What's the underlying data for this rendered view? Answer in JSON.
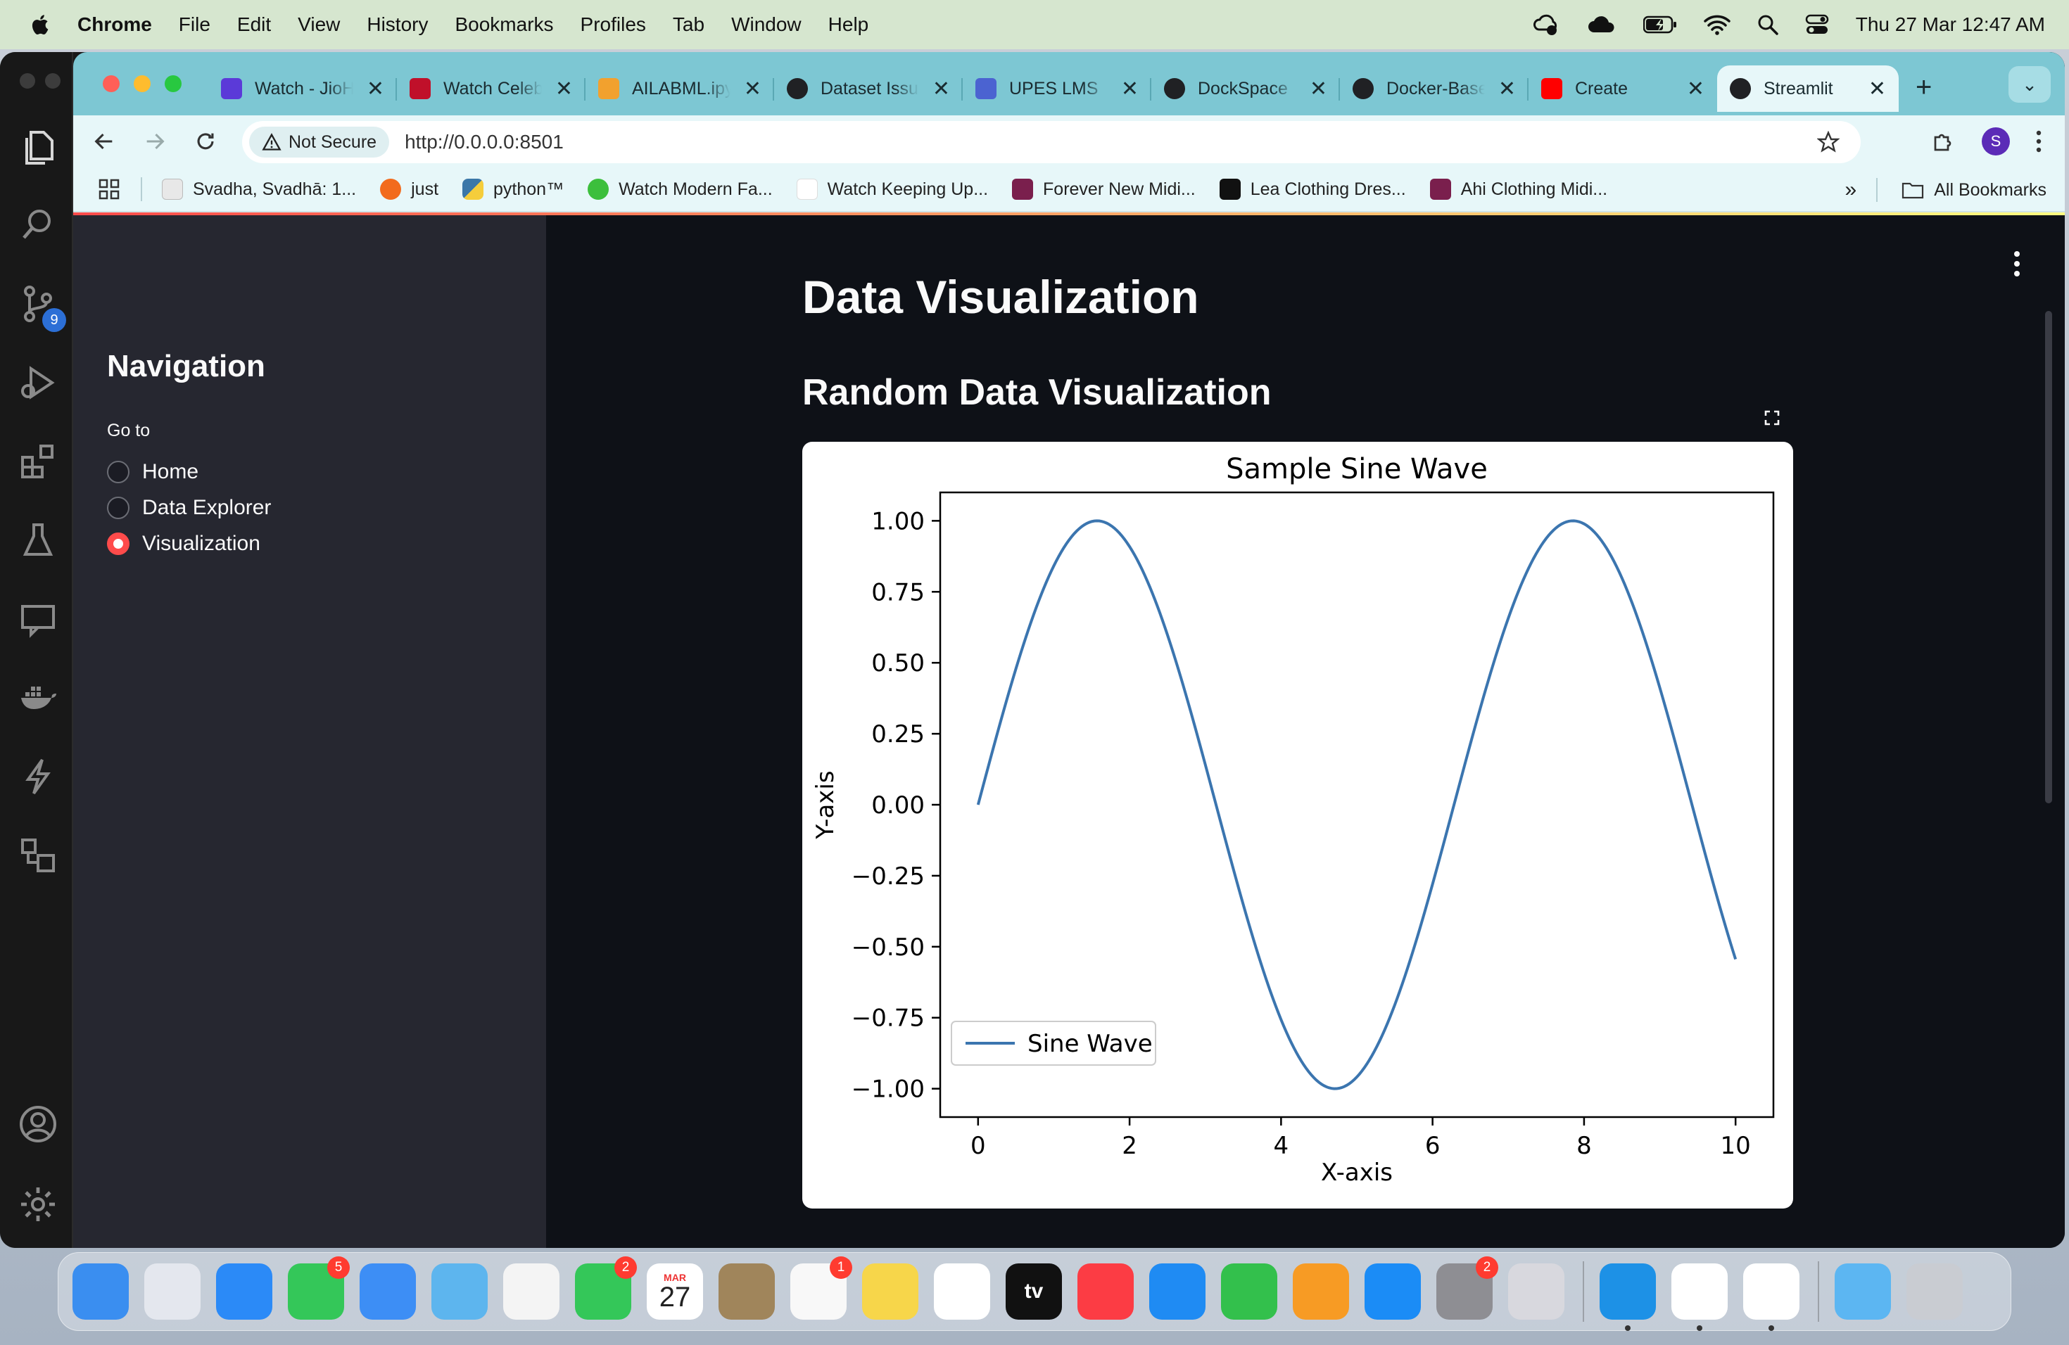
{
  "menubar": {
    "app_name": "Chrome",
    "items": [
      "File",
      "Edit",
      "View",
      "History",
      "Bookmarks",
      "Profiles",
      "Tab",
      "Window",
      "Help"
    ],
    "datetime": "Thu 27 Mar  12:47 AM"
  },
  "activity_bar": {
    "icons": [
      "files-icon",
      "search-icon",
      "source-control-icon",
      "run-debug-icon",
      "extensions-icon",
      "testing-icon",
      "remote-explorer-icon",
      "docker-icon",
      "lightning-icon",
      "layout-icon"
    ],
    "source_control_badge": "9",
    "bottom_icons": [
      "account-icon",
      "settings-icon"
    ]
  },
  "tabs": [
    {
      "title": "Watch - JioHotstar",
      "color": "#5b3ad8"
    },
    {
      "title": "Watch Celebrity",
      "color": "#c0102a"
    },
    {
      "title": "AILABML.ipynb",
      "color": "#f2a12e"
    },
    {
      "title": "Dataset Issues",
      "color": "#202124"
    },
    {
      "title": "UPES LMS",
      "color": "#4b63d1"
    },
    {
      "title": "DockSpace",
      "color": "#202124"
    },
    {
      "title": "Docker-Based",
      "color": "#202124"
    },
    {
      "title": "Create",
      "color": "#ff0000"
    },
    {
      "title": "Streamlit",
      "color": "#202124"
    }
  ],
  "toolbar": {
    "security_label": "Not Secure",
    "url": "http://0.0.0.0:8501",
    "profile_initial": "S"
  },
  "bookmarks": [
    {
      "label": "Svadha, Svadhā: 1...",
      "color": "#e8e8e8"
    },
    {
      "label": "just",
      "color": "#f26b1d"
    },
    {
      "label": "python™",
      "color": "#3b77a8"
    },
    {
      "label": "Watch Modern Fa...",
      "color": "#3cbf3c"
    },
    {
      "label": "Watch Keeping Up...",
      "color": "#ffffff"
    },
    {
      "label": "Forever New Midi...",
      "color": "#7a1f4d"
    },
    {
      "label": "Lea Clothing Dres...",
      "color": "#111111"
    },
    {
      "label": "Ahi Clothing Midi...",
      "color": "#7a1f4d"
    }
  ],
  "all_bookmarks_label": "All Bookmarks",
  "sidebar": {
    "title": "Navigation",
    "radio_label": "Go to",
    "options": [
      "Home",
      "Data Explorer",
      "Visualization"
    ],
    "selected": "Visualization"
  },
  "main": {
    "title": "Data Visualization",
    "subtitle": "Random Data Visualization"
  },
  "chart_data": {
    "type": "line",
    "title": "Sample Sine Wave",
    "xlabel": "X-axis",
    "ylabel": "Y-axis",
    "xlim": [
      -0.5,
      10.5
    ],
    "ylim": [
      -1.1,
      1.1
    ],
    "xticks": [
      0,
      2,
      4,
      6,
      8,
      10
    ],
    "yticks": [
      1.0,
      0.75,
      0.5,
      0.25,
      0.0,
      -0.25,
      -0.5,
      -0.75,
      -1.0
    ],
    "ytick_labels": [
      "1.00",
      "0.75",
      "0.50",
      "0.25",
      "0.00",
      "−0.25",
      "−0.50",
      "−0.75",
      "−1.00"
    ],
    "series": [
      {
        "name": "Sine Wave",
        "color": "#3b75af",
        "function": "sin(x)",
        "x_range": [
          0,
          10
        ]
      }
    ],
    "legend": "lower-left",
    "grid": false
  },
  "dock": {
    "apps": [
      {
        "name": "finder",
        "color": "#3a8ef0",
        "badge": ""
      },
      {
        "name": "launchpad",
        "color": "#e4e7ee",
        "badge": ""
      },
      {
        "name": "safari",
        "color": "#2b8af7",
        "badge": ""
      },
      {
        "name": "messages",
        "color": "#34c759",
        "badge": "5"
      },
      {
        "name": "mail",
        "color": "#3d8ef5",
        "badge": ""
      },
      {
        "name": "maps",
        "color": "#5db5ee",
        "badge": ""
      },
      {
        "name": "photos",
        "color": "#f4f4f4",
        "badge": ""
      },
      {
        "name": "facetime",
        "color": "#34c759",
        "badge": "2"
      },
      {
        "name": "calendar",
        "color": "#ffffff",
        "badge": ""
      },
      {
        "name": "contacts",
        "color": "#a0855b",
        "badge": ""
      },
      {
        "name": "reminders",
        "color": "#f8f8f8",
        "badge": "1"
      },
      {
        "name": "notes",
        "color": "#f7d64a",
        "badge": ""
      },
      {
        "name": "freeform",
        "color": "#ffffff",
        "badge": ""
      },
      {
        "name": "tv",
        "color": "#111111",
        "badge": ""
      },
      {
        "name": "music",
        "color": "#fc3c44",
        "badge": ""
      },
      {
        "name": "keynote",
        "color": "#1f8bf3",
        "badge": ""
      },
      {
        "name": "numbers",
        "color": "#33c04c",
        "badge": ""
      },
      {
        "name": "pages",
        "color": "#f79b24",
        "badge": ""
      },
      {
        "name": "app-store",
        "color": "#1b8cf6",
        "badge": ""
      },
      {
        "name": "system-settings",
        "color": "#8e8e93",
        "badge": "2"
      },
      {
        "name": "iphone-mirroring",
        "color": "#d8d8de",
        "badge": ""
      }
    ],
    "apps_right": [
      {
        "name": "docker",
        "color": "#1d91e6",
        "badge": ""
      },
      {
        "name": "vscode",
        "color": "#ffffff",
        "badge": ""
      },
      {
        "name": "chrome",
        "color": "#ffffff",
        "badge": ""
      }
    ],
    "extras": [
      {
        "name": "downloads-folder",
        "color": "#5cb6f2"
      },
      {
        "name": "trash",
        "color": "#c9ccd2"
      }
    ],
    "calendar": {
      "month": "MAR",
      "day": "27"
    },
    "tv_label": "tv"
  }
}
